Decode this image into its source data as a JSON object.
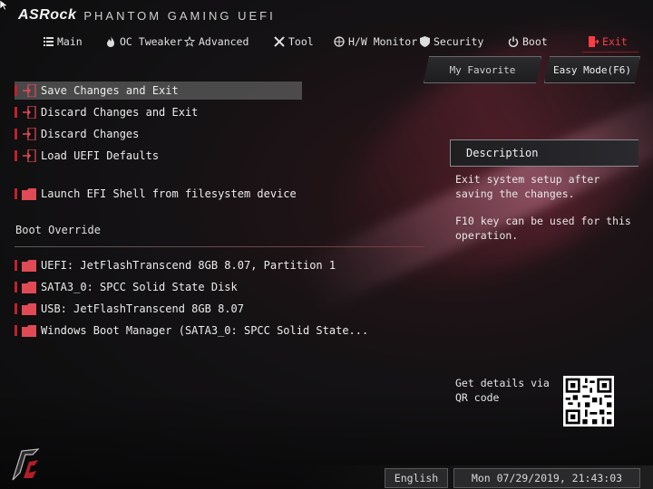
{
  "brand": {
    "logo": "ASRock",
    "subtitle": "PHANTOM GAMING UEFI"
  },
  "tabs": [
    {
      "label": "Main",
      "icon": "list-icon"
    },
    {
      "label": "OC Tweaker",
      "icon": "flame-icon"
    },
    {
      "label": "Advanced",
      "icon": "star-icon"
    },
    {
      "label": "Tool",
      "icon": "tools-icon"
    },
    {
      "label": "H/W Monitor",
      "icon": "monitor-icon"
    },
    {
      "label": "Security",
      "icon": "shield-icon"
    },
    {
      "label": "Boot",
      "icon": "power-icon"
    },
    {
      "label": "Exit",
      "icon": "exit-icon",
      "active": true
    }
  ],
  "buttons": {
    "favorite": "My Favorite",
    "easy_mode": "Easy Mode(F6)"
  },
  "menu": [
    {
      "label": "Save Changes and Exit",
      "icon": "exit-door-icon",
      "selected": true
    },
    {
      "label": "Discard Changes and Exit",
      "icon": "exit-door-icon"
    },
    {
      "label": "Discard Changes",
      "icon": "exit-door-icon"
    },
    {
      "label": "Load UEFI Defaults",
      "icon": "exit-door-icon"
    },
    {
      "label": "Launch EFI Shell from filesystem device",
      "icon": "folder-icon"
    }
  ],
  "boot_override": {
    "title": "Boot Override",
    "items": [
      {
        "label": "UEFI: JetFlashTranscend 8GB 8.07, Partition 1",
        "icon": "folder-icon"
      },
      {
        "label": "SATA3_0: SPCC Solid State Disk",
        "icon": "folder-icon"
      },
      {
        "label": "USB: JetFlashTranscend 8GB 8.07",
        "icon": "folder-icon"
      },
      {
        "label": "Windows Boot Manager (SATA3_0: SPCC Solid State...",
        "icon": "folder-icon"
      }
    ]
  },
  "description": {
    "title": "Description",
    "line1": "Exit system setup after saving the changes.",
    "line2": "F10 key can be used for this operation."
  },
  "qr": {
    "label": "Get details via QR code"
  },
  "footer": {
    "language": "English",
    "datetime": "Mon 07/29/2019, 21:43:03"
  },
  "colors": {
    "accent": "#ff3b44",
    "marker": "#c3202b",
    "selected_bg": "#6e6e6e"
  }
}
